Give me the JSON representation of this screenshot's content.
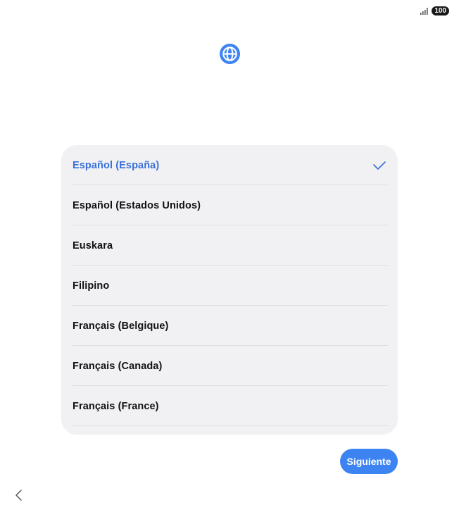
{
  "status_bar": {
    "signal_icon": "signal-bars-icon",
    "battery_level": "100"
  },
  "header": {
    "icon": "globe-icon",
    "accent_color": "#3d84f2"
  },
  "language_list": {
    "selected_index": 0,
    "items": [
      {
        "label": "Español (España)",
        "selected": true
      },
      {
        "label": "Español (Estados Unidos)",
        "selected": false
      },
      {
        "label": "Euskara",
        "selected": false
      },
      {
        "label": "Filipino",
        "selected": false
      },
      {
        "label": "Français (Belgique)",
        "selected": false
      },
      {
        "label": "Français (Canada)",
        "selected": false
      },
      {
        "label": "Français (France)",
        "selected": false
      }
    ]
  },
  "footer": {
    "next_label": "Siguiente",
    "back_icon": "chevron-left-icon"
  },
  "colors": {
    "selected_text": "#3b6fd9",
    "button_bg": "#3d84f2",
    "list_bg": "#f1f1f4"
  }
}
